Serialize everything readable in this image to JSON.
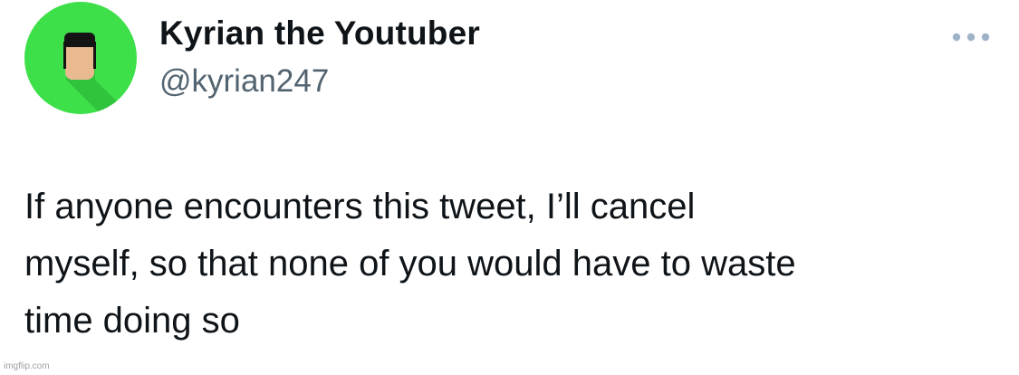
{
  "tweet": {
    "author": {
      "display_name": "Kyrian the Youtuber",
      "handle": "@kyrian247",
      "avatar_icon": "roblox-head-avatar-icon",
      "avatar_color": "#3ee04a"
    },
    "more_icon": "more-horizontal-icon",
    "text_lines": [
      "If anyone encounters this tweet, I’ll cancel",
      "myself, so that none of you would have to waste",
      "time doing so"
    ]
  },
  "watermark": "imgflip.com"
}
